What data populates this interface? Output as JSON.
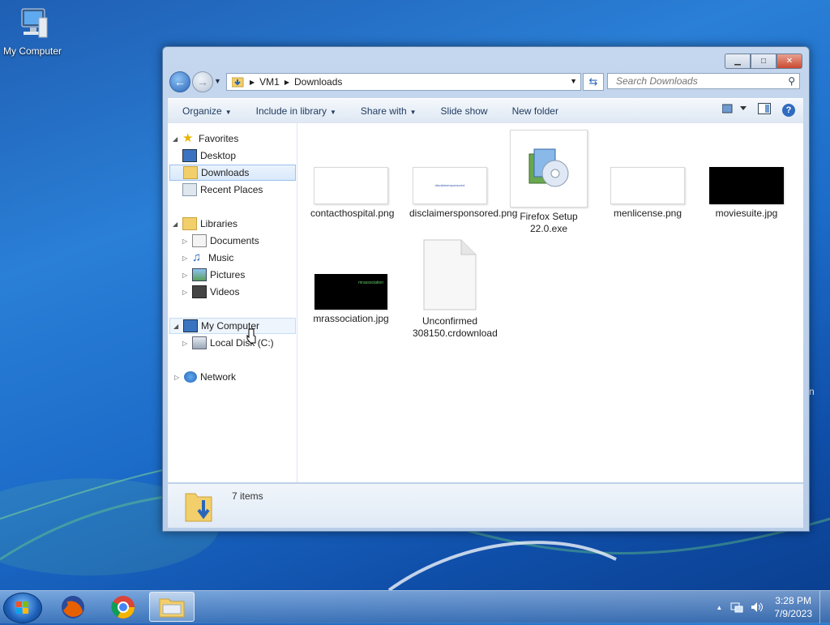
{
  "desktop": {
    "icon_label": "My Computer",
    "edge_glyph": "n"
  },
  "window": {
    "caption": {
      "minimize": "▁",
      "maximize": "□",
      "close": "✕"
    },
    "address": {
      "crumbs": [
        "VM1",
        "Downloads"
      ]
    },
    "search": {
      "placeholder": "Search Downloads"
    },
    "toolbar": {
      "organize": "Organize",
      "include": "Include in library",
      "share": "Share with",
      "slideshow": "Slide show",
      "newfolder": "New folder",
      "help": "?"
    },
    "nav": {
      "favorites": "Favorites",
      "desktop": "Desktop",
      "downloads": "Downloads",
      "recent": "Recent Places",
      "libraries": "Libraries",
      "documents": "Documents",
      "music": "Music",
      "pictures": "Pictures",
      "videos": "Videos",
      "computer": "My Computer",
      "localdisk": "Local Disk (C:)",
      "network": "Network"
    },
    "files": [
      {
        "name": "contacthospital.png"
      },
      {
        "name": "disclaimersponsored.png",
        "thumb_text": "disclaimersponsored"
      },
      {
        "name": "Firefox Setup 22.0.exe"
      },
      {
        "name": "menlicense.png"
      },
      {
        "name": "moviesuite.jpg"
      },
      {
        "name": "mrassociation.jpg",
        "thumb_text": "mrassociation"
      },
      {
        "name": "Unconfirmed 308150.crdownload"
      }
    ],
    "details": {
      "count": "7 items"
    }
  },
  "taskbar": {
    "time": "3:28 PM",
    "date": "7/9/2023"
  },
  "colors": {
    "accent": "#2a66b8",
    "selection": "#d9e9fb"
  }
}
